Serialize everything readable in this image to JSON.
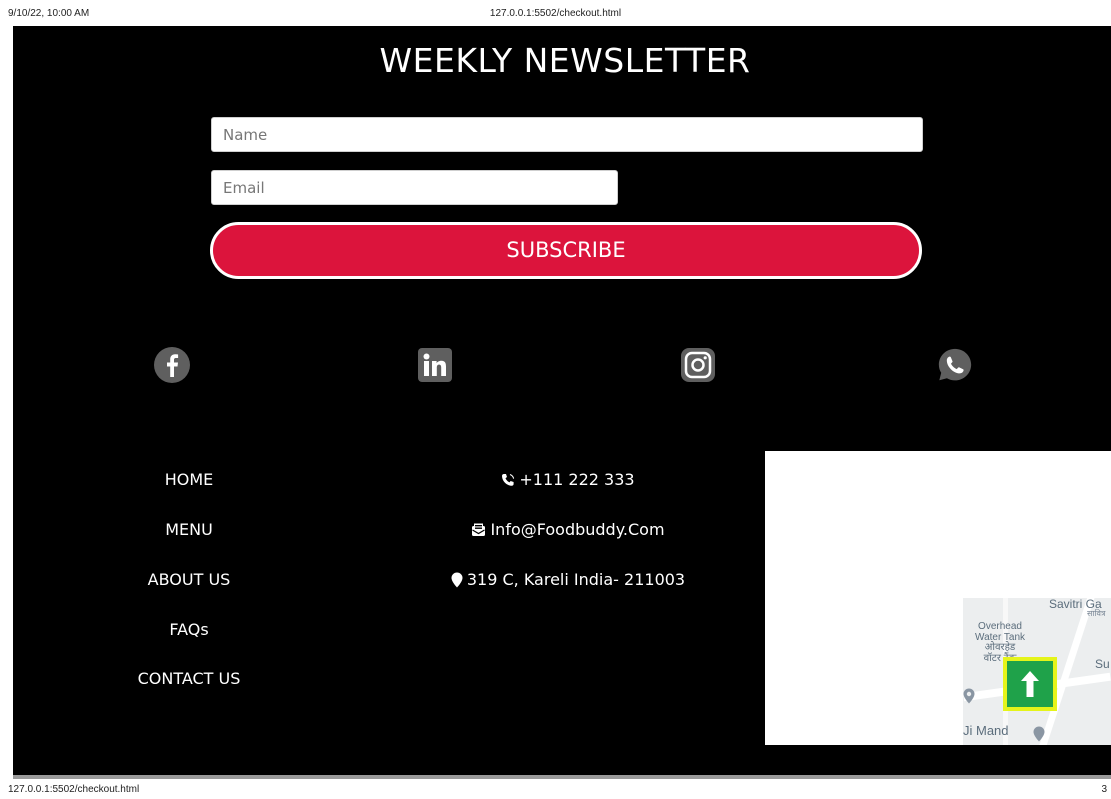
{
  "browser": {
    "datetime": "9/10/22, 10:00 AM",
    "page_url": "127.0.0.1:5502/checkout.html",
    "footer_url": "127.0.0.1:5502/checkout.html",
    "page_number": "3"
  },
  "newsletter": {
    "title": "WEEKLY NEWSLETTER",
    "name_placeholder": "Name",
    "email_placeholder": "Email",
    "subscribe_label": "SUBSCRIBE"
  },
  "social": [
    {
      "name": "facebook",
      "icon": "facebook-icon"
    },
    {
      "name": "linkedin",
      "icon": "linkedin-icon"
    },
    {
      "name": "instagram",
      "icon": "instagram-icon"
    },
    {
      "name": "whatsapp",
      "icon": "whatsapp-icon"
    }
  ],
  "nav": {
    "home": "HOME",
    "menu": "MENU",
    "about": "ABOUT US",
    "faqs": "FAQs",
    "contact": "CONTACT US"
  },
  "contact": {
    "phone": "+111 222 333",
    "email": "Info@Foodbuddy.Com",
    "address": "319 C, Kareli India- 211003"
  },
  "map": {
    "label_savitri": "Savitri Ga",
    "label_savitri_hindi": "सावित्र",
    "label_tank": "Overhead\nWater Tank\nओवरहेड\nवॉटर टैंक",
    "label_su": "Su",
    "label_mandir": "Ji Mand"
  },
  "colors": {
    "background": "#000000",
    "subscribe": "#dc143c",
    "scroll_top_bg": "#1fa24a",
    "scroll_top_border": "#e5f41a",
    "social_icon": "#5f5f5f"
  }
}
